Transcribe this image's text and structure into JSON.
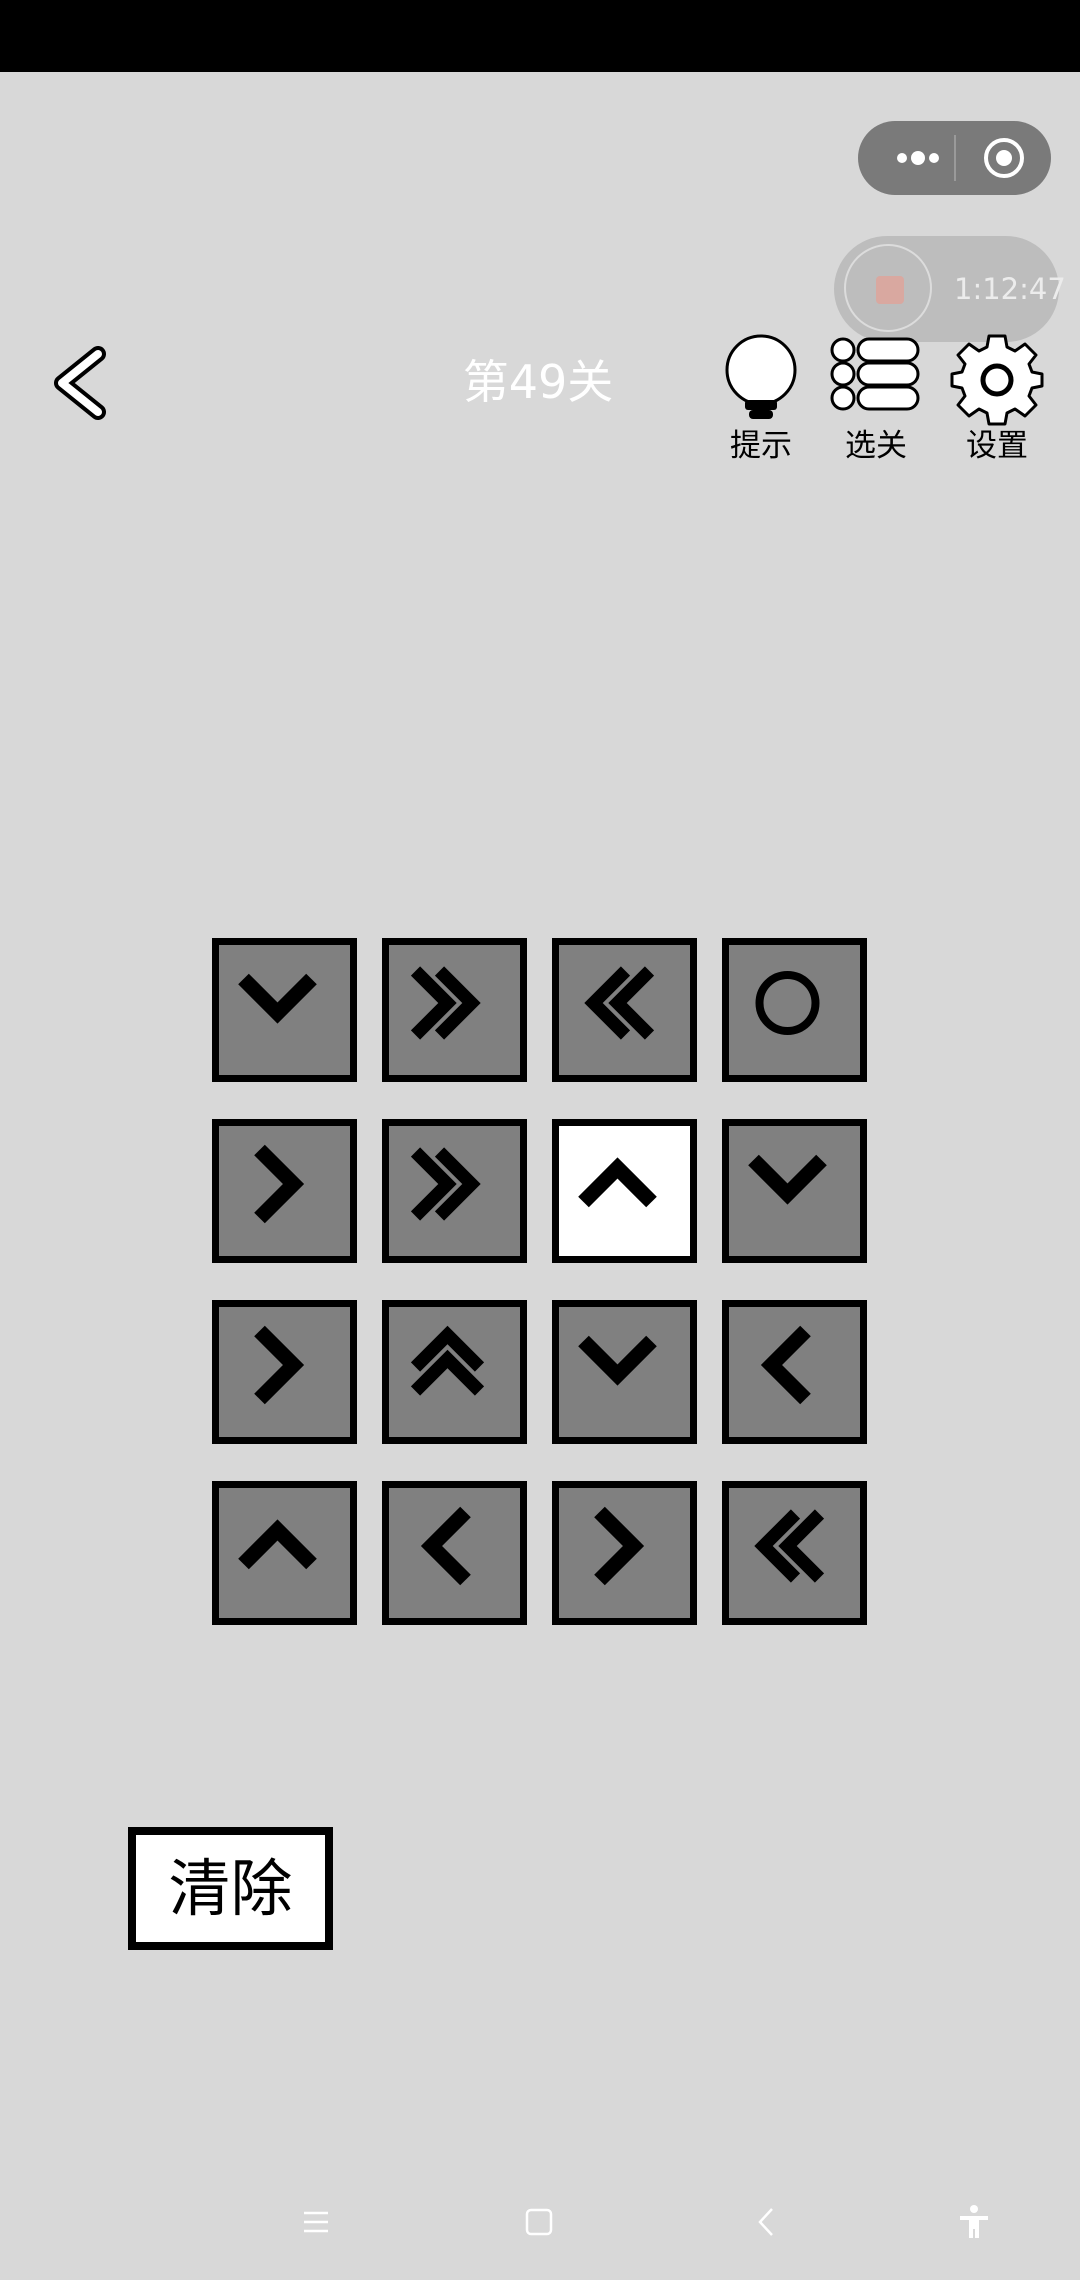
{
  "header": {
    "level_title": "第49关",
    "tools": [
      {
        "label": "提示",
        "icon": "lightbulb-icon"
      },
      {
        "label": "选关",
        "icon": "level-list-icon"
      },
      {
        "label": "设置",
        "icon": "gear-icon"
      }
    ],
    "back_icon": "chevron-left-icon"
  },
  "capsule": {
    "menu_icon": "more-dots-icon",
    "close_icon": "target-circle-icon"
  },
  "recording": {
    "timer": "1:12:47",
    "stop_icon": "record-stop-icon"
  },
  "board": {
    "rows": 4,
    "cols": 4,
    "tiles": [
      [
        "down",
        "double-right",
        "double-left",
        "circle"
      ],
      [
        "right",
        "double-right",
        "up",
        "down"
      ],
      [
        "right",
        "double-up",
        "down",
        "left"
      ],
      [
        "up",
        "left",
        "right",
        "double-left"
      ]
    ],
    "selected": {
      "row": 1,
      "col": 2
    }
  },
  "actions": {
    "clear_label": "清除"
  },
  "nav": {
    "icons": [
      "menu-icon",
      "home-square-icon",
      "back-triangle-icon",
      "accessibility-icon"
    ]
  },
  "colors": {
    "background": "#d8d8d8",
    "tile": "#808080",
    "tile_selected": "#ffffff",
    "border": "#000000"
  }
}
